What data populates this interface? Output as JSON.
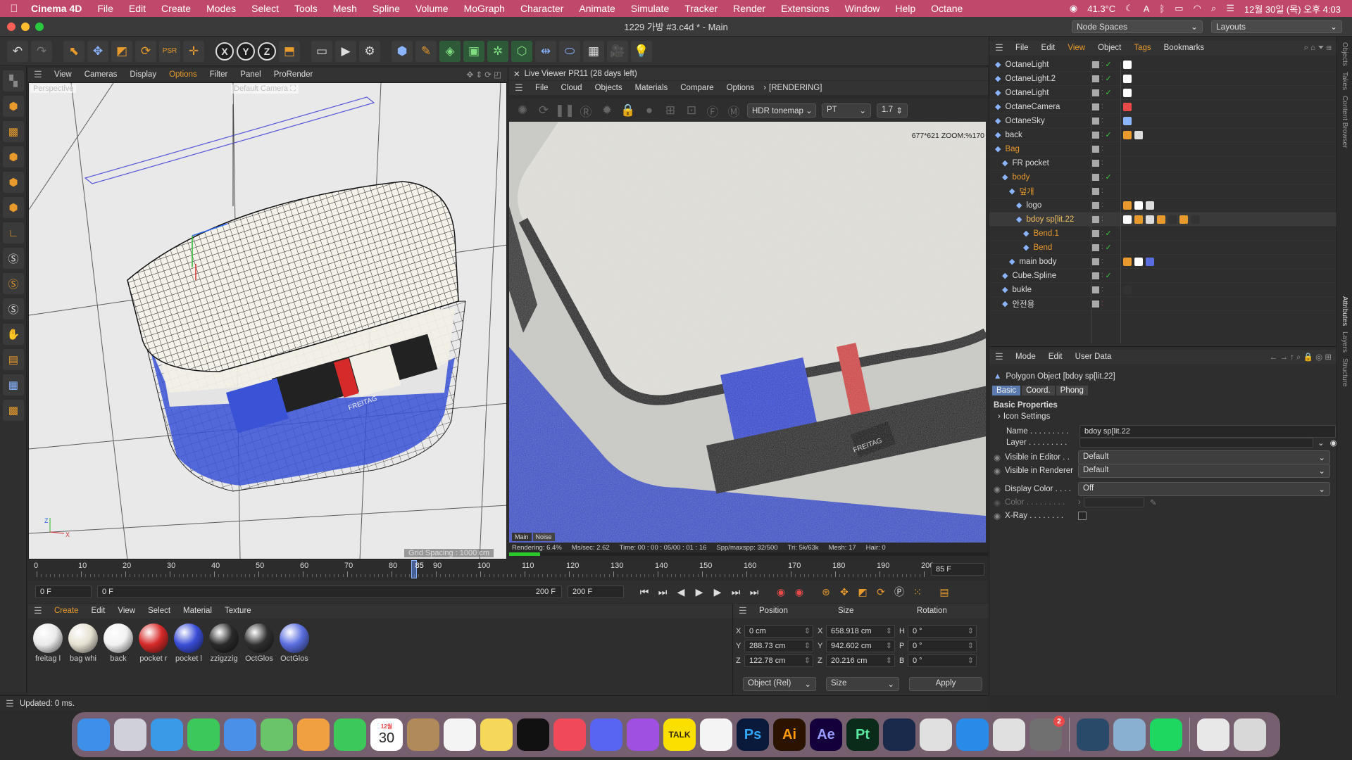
{
  "menubar": {
    "app": "Cinema 4D",
    "items": [
      "File",
      "Edit",
      "Create",
      "Modes",
      "Select",
      "Tools",
      "Mesh",
      "Spline",
      "Volume",
      "MoGraph",
      "Character",
      "Animate",
      "Simulate",
      "Tracker",
      "Render",
      "Extensions",
      "Window",
      "Help",
      "Octane"
    ],
    "temp": "41.3°C",
    "datetime": "12월 30일 (목) 오후 4:03"
  },
  "window": {
    "title": "1229 가방 #3.c4d * - Main",
    "node_spaces": "Node Spaces",
    "layouts": "Layouts"
  },
  "viewport": {
    "menu": [
      "View",
      "Cameras",
      "Display",
      "Options",
      "Filter",
      "Panel",
      "ProRender"
    ],
    "label": "Perspective",
    "camera": "Default Camera",
    "grid_spacing": "Grid Spacing : 1000 cm"
  },
  "liveviewer": {
    "title": "Live Viewer PR11 (28 days left)",
    "menu": [
      "File",
      "Cloud",
      "Objects",
      "Materials",
      "Compare",
      "Options"
    ],
    "status": "[RENDERING]",
    "tonemap": "HDR tonemap",
    "mode": "PT",
    "value": "1.7",
    "zoom": "677*621 ZOOM:%170",
    "tabs": [
      "Main",
      "Noise"
    ],
    "stats": [
      "Rendering: 6.4%",
      "Ms/sec: 2.62",
      "Time: 00 : 00 : 05/00 : 01 : 16",
      "Spp/maxspp: 32/500",
      "Tri: 5k/63k",
      "Mesh: 17",
      "Hair: 0"
    ],
    "progress": 0.064
  },
  "timeline": {
    "ticks": [
      "0",
      "10",
      "20",
      "30",
      "40",
      "50",
      "60",
      "70",
      "80",
      "90",
      "100",
      "110",
      "120",
      "130",
      "140",
      "150",
      "160",
      "170",
      "180",
      "190",
      "200"
    ],
    "current": "85",
    "current_field": "85 F"
  },
  "transport": {
    "start": "0 F",
    "range_start": "0 F",
    "range_end": "200 F",
    "end": "200 F"
  },
  "materials": {
    "menu": [
      "Create",
      "Edit",
      "View",
      "Select",
      "Material",
      "Texture"
    ],
    "items": [
      {
        "label": "freitag l",
        "color": "#eaeaea"
      },
      {
        "label": "bag whi",
        "color": "#e6e0d2"
      },
      {
        "label": "back",
        "color": "#f2f2f2"
      },
      {
        "label": "pocket r",
        "color": "#d62a2a"
      },
      {
        "label": "pocket l",
        "color": "#3a4ed8"
      },
      {
        "label": "zzigzzig",
        "color": "#2a2a2a"
      },
      {
        "label": "OctGlos",
        "color": "#303030"
      },
      {
        "label": "OctGlos",
        "color": "#5a6ee0"
      }
    ]
  },
  "coords": {
    "headers": [
      "Position",
      "Size",
      "Rotation"
    ],
    "rows": [
      {
        "a": "X",
        "pos": "0 cm",
        "b": "X",
        "size": "658.918 cm",
        "c": "H",
        "rot": "0 °"
      },
      {
        "a": "Y",
        "pos": "288.73 cm",
        "b": "Y",
        "size": "942.602 cm",
        "c": "P",
        "rot": "0 °"
      },
      {
        "a": "Z",
        "pos": "122.78 cm",
        "b": "Z",
        "size": "20.216 cm",
        "c": "B",
        "rot": "0 °"
      }
    ],
    "mode": "Object (Rel)",
    "size_mode": "Size",
    "apply": "Apply"
  },
  "status": "Updated: 0 ms.",
  "objects": {
    "menu": [
      "File",
      "Edit",
      "View",
      "Object",
      "Tags",
      "Bookmarks"
    ],
    "rows": [
      {
        "name": "OctaneLight",
        "indent": 0,
        "color": "#ddd"
      },
      {
        "name": "OctaneLight.2",
        "indent": 0,
        "color": "#ddd"
      },
      {
        "name": "OctaneLight",
        "indent": 0,
        "color": "#ddd"
      },
      {
        "name": "OctaneCamera",
        "indent": 0,
        "color": "#ddd"
      },
      {
        "name": "OctaneSky",
        "indent": 0,
        "color": "#ddd"
      },
      {
        "name": "back",
        "indent": 0,
        "color": "#ddd"
      },
      {
        "name": "Bag",
        "indent": 0,
        "color": "#e89a2c"
      },
      {
        "name": "FR pocket",
        "indent": 1,
        "color": "#ddd"
      },
      {
        "name": "body",
        "indent": 1,
        "color": "#e89a2c"
      },
      {
        "name": "덮개",
        "indent": 2,
        "color": "#e89a2c"
      },
      {
        "name": "logo",
        "indent": 3,
        "color": "#ddd"
      },
      {
        "name": "bdoy sp[lit.22",
        "indent": 3,
        "color": "#f0c060"
      },
      {
        "name": "Bend.1",
        "indent": 4,
        "color": "#e89a2c"
      },
      {
        "name": "Bend",
        "indent": 4,
        "color": "#e89a2c"
      },
      {
        "name": "main body",
        "indent": 2,
        "color": "#ddd"
      },
      {
        "name": "Cube.Spline",
        "indent": 1,
        "color": "#ddd"
      },
      {
        "name": "bukle",
        "indent": 1,
        "color": "#ddd"
      },
      {
        "name": "안전용",
        "indent": 1,
        "color": "#ddd"
      }
    ]
  },
  "attributes": {
    "menu": [
      "Mode",
      "Edit",
      "User Data"
    ],
    "object": "Polygon Object [bdoy sp[lit.22]",
    "tabs": [
      "Basic",
      "Coord.",
      "Phong"
    ],
    "section": "Basic Properties",
    "icon_settings": "Icon Settings",
    "name_label": "Name",
    "name_value": "bdoy sp[lit.22",
    "layer_label": "Layer",
    "vis_editor_label": "Visible in Editor",
    "vis_editor": "Default",
    "vis_render_label": "Visible in Renderer",
    "vis_render": "Default",
    "display_color_label": "Display Color",
    "display_color": "Off",
    "color_label": "Color",
    "xray_label": "X-Ray"
  },
  "side_tabs": [
    "Objects",
    "Takes",
    "Content Browser",
    "Attributes",
    "Layers",
    "Structure"
  ],
  "dock": {
    "calendar_month": "12월",
    "calendar_day": "30",
    "badge": "2",
    "apps": [
      {
        "name": "finder-icon",
        "label": "",
        "color": "#3d8fe8"
      },
      {
        "name": "launchpad-icon",
        "label": "",
        "color": "#d0d0d8"
      },
      {
        "name": "safari-icon",
        "label": "",
        "color": "#3a9ae8"
      },
      {
        "name": "messages-icon",
        "label": "",
        "color": "#3dc85a"
      },
      {
        "name": "mail-icon",
        "label": "",
        "color": "#4a90e8"
      },
      {
        "name": "maps-icon",
        "label": "",
        "color": "#6ac46a"
      },
      {
        "name": "photos-icon",
        "label": "",
        "color": "#f0a040"
      },
      {
        "name": "facetime-icon",
        "label": "",
        "color": "#3dc85a"
      },
      {
        "name": "calendar-icon",
        "label": "",
        "color": "#ffffff"
      },
      {
        "name": "contacts-icon",
        "label": "",
        "color": "#b08a5a"
      },
      {
        "name": "reminders-icon",
        "label": "",
        "color": "#f4f4f4"
      },
      {
        "name": "notes-icon",
        "label": "",
        "color": "#f5d75a"
      },
      {
        "name": "tv-icon",
        "label": "",
        "color": "#111111"
      },
      {
        "name": "music-icon",
        "label": "",
        "color": "#f04a5a"
      },
      {
        "name": "discord-icon",
        "label": "",
        "color": "#5865f2"
      },
      {
        "name": "podcasts-icon",
        "label": "",
        "color": "#a050e0"
      },
      {
        "name": "kakaotalk-icon",
        "label": "TALK",
        "color": "#f9e000"
      },
      {
        "name": "cinema4d-mannequin-icon",
        "label": "",
        "color": "#f4f4f4"
      },
      {
        "name": "photoshop-icon",
        "label": "Ps",
        "color": "#0a1a3a"
      },
      {
        "name": "illustrator-icon",
        "label": "Ai",
        "color": "#2a1400"
      },
      {
        "name": "aftereffects-icon",
        "label": "Ae",
        "color": "#14003a"
      },
      {
        "name": "pt-icon",
        "label": "Pt",
        "color": "#0a2a1a"
      },
      {
        "name": "cinema4d-icon",
        "label": "",
        "color": "#1a2a4a"
      },
      {
        "name": "blender-icon",
        "label": "",
        "color": "#e0e0e0"
      },
      {
        "name": "appstore-icon",
        "label": "",
        "color": "#2a8ae8"
      },
      {
        "name": "script-editor-icon",
        "label": "",
        "color": "#e0e0e0"
      },
      {
        "name": "system-preferences-icon",
        "label": "",
        "color": "#707070"
      },
      {
        "name": "quicktime-icon",
        "label": "",
        "color": "#2a4a6a"
      },
      {
        "name": "preview-icon",
        "label": "",
        "color": "#8ab0d0"
      },
      {
        "name": "spotify-icon",
        "label": "",
        "color": "#1ed760"
      },
      {
        "name": "document-icon",
        "label": "",
        "color": "#e8e8e8"
      },
      {
        "name": "trash-icon",
        "label": "",
        "color": "#d8d8d8"
      }
    ]
  }
}
